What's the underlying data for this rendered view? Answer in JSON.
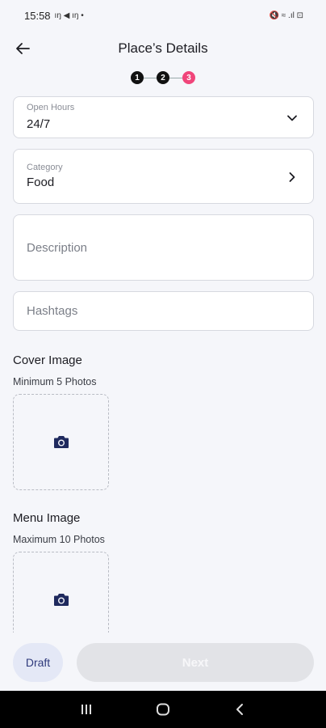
{
  "status_bar": {
    "time": "15:58",
    "left_glyphs": "ıŋ ◀ ıŋ •",
    "right_glyphs": "🔇 ≈ .ıl ⊡"
  },
  "header": {
    "title": "Place’s Details"
  },
  "stepper": {
    "steps": [
      "1",
      "2",
      "3"
    ],
    "active_color": "#f0457a"
  },
  "form": {
    "open_hours": {
      "label": "Open Hours",
      "value": "24/7"
    },
    "category": {
      "label": "Category",
      "value": "Food"
    },
    "description": {
      "placeholder": "Description"
    },
    "hashtags": {
      "placeholder": "Hashtags"
    }
  },
  "cover_image": {
    "title": "Cover Image",
    "subtitle": "Minimum 5 Photos"
  },
  "menu_image": {
    "title": "Menu Image",
    "subtitle": "Maximum 10 Photos"
  },
  "actions": {
    "draft_label": "Draft",
    "next_label": "Next"
  },
  "icons": {
    "back": "arrow-left-icon",
    "dropdown": "chevron-down-icon",
    "chevron": "chevron-right-icon",
    "camera": "camera-icon"
  }
}
